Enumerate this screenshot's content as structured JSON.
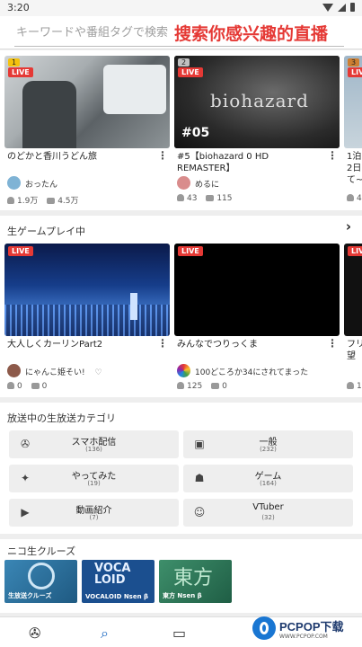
{
  "status": {
    "time": "3:20"
  },
  "search": {
    "placeholder": "キーワードや番組タグで検索",
    "overlay": "搜索你感兴趣的直播"
  },
  "live_label": "LIVE",
  "top_cards": [
    {
      "rank": "1",
      "title": "のどかと香川うどん旅",
      "user": "おったん",
      "viewers": "1.9万",
      "comments": "4.5万"
    },
    {
      "rank": "2",
      "title": "#5【biohazard 0 HD REMASTER】",
      "user": "めるに",
      "viewers": "43",
      "comments": "115",
      "thumb_text": "biohazard",
      "thumb_sub": "#05"
    },
    {
      "rank": "3",
      "title": "1泊2日て~",
      "user": "",
      "viewers": "4",
      "comments": ""
    }
  ],
  "game_section": {
    "title": "生ゲームプレイ中",
    "arrow": "›"
  },
  "game_cards": [
    {
      "title": "大人しくカーリンPart2",
      "user": "にゃんこ姫そい!",
      "viewers": "0",
      "comments": "0",
      "heart": "♡"
    },
    {
      "title": "みんなでつりっくま",
      "user": "100どころか34にされてまった",
      "viewers": "125",
      "comments": "0"
    },
    {
      "title": "フリ望",
      "user": "",
      "viewers": "1",
      "comments": ""
    }
  ],
  "category_section": {
    "title": "放送中の生放送カテゴリ"
  },
  "categories": [
    {
      "name": "スマホ配信",
      "count": "(136)",
      "icon": "smartphone-broadcast-icon",
      "glyph": "✇"
    },
    {
      "name": "一般",
      "count": "(232)",
      "icon": "general-icon",
      "glyph": "▣"
    },
    {
      "name": "やってみた",
      "count": "(19)",
      "icon": "sparkle-icon",
      "glyph": "✦"
    },
    {
      "name": "ゲーム",
      "count": "(164)",
      "icon": "gamepad-icon",
      "glyph": "☗"
    },
    {
      "name": "動画紹介",
      "count": "(7)",
      "icon": "video-play-icon",
      "glyph": "▶"
    },
    {
      "name": "VTuber",
      "count": "(32)",
      "icon": "vtuber-icon",
      "glyph": "☺"
    }
  ],
  "cruise_section": {
    "title": "ニコ生クルーズ"
  },
  "cruise": [
    {
      "label": "生放送クルーズ",
      "color": "#2a6f93"
    },
    {
      "label": "VOCALOID Nsen β",
      "color": "#1b4f8f",
      "big": "VOCA\nLOID"
    },
    {
      "label": "東方 Nsen β",
      "color": "#2e7d5a",
      "big": "東方"
    }
  ],
  "watermark": {
    "text": "PCPOP下载",
    "sub": "WWW.PCPOP.COM"
  },
  "colors": {
    "accent": "#e53935",
    "brand": "#1976d2"
  }
}
